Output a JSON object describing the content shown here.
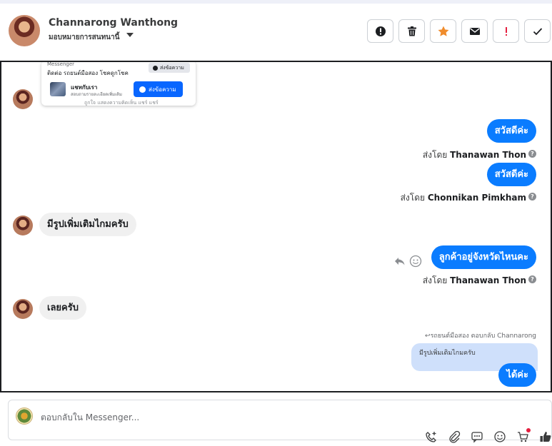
{
  "header": {
    "contact_name": "Channarong Wanthong",
    "assign_label": "มอบหมายการสนทนานี้",
    "actions": [
      {
        "icon": "alert-circle-icon",
        "color": "#1c1e21"
      },
      {
        "icon": "trash-icon",
        "color": "#1c1e21"
      },
      {
        "icon": "star-icon",
        "color": "#f08c2c"
      },
      {
        "icon": "envelope-icon",
        "color": "#1c1e21"
      },
      {
        "icon": "exclamation-icon",
        "color": "#e41e3f"
      },
      {
        "icon": "check-icon",
        "color": "#1c1e21"
      }
    ]
  },
  "ad_card": {
    "brand": "Messenger",
    "title": "ติดต่อ รถยนต์มือสอง โชคดูกโชค",
    "send_top": "ส่งข้อความ",
    "page_name": "แชทกับเรา",
    "page_sub": "สอบถามรายละเอียดเพิ่มเติม",
    "send_main": "ส่งข้อความ",
    "cut_text": "ถูกใจ    แสดงความคิดเห็น    แชร์    แชร์"
  },
  "messages": {
    "out1": "สวัสดีค่ะ",
    "sent1_prefix": "ส่งโดย",
    "sent1_name": "Thanawan Thon",
    "out2": "สวัสดีค่ะ",
    "sent2_prefix": "ส่งโดย",
    "sent2_name": "Chonnikan Pimkham",
    "in1": "มีรูปเพิ่มเติมไกมครับ",
    "out3": "ลูกค้าอยู่จังหวัดไหนคะ",
    "sent3_prefix": "ส่งโดย",
    "sent3_name": "Thanawan Thon",
    "in2": "เลยครับ",
    "reply_note": "รถยนต์มือสอง ตอบกลับ Channarong",
    "quoted": "มีรูปเพิ่มเติมไกมครับ",
    "out4": "ได้ค่ะ"
  },
  "composer": {
    "placeholder": "ตอบกลับใน Messenger..."
  },
  "colors": {
    "accent": "#0a7cff",
    "incoming": "#f0f0f0",
    "quoted": "#cfe0fb"
  }
}
